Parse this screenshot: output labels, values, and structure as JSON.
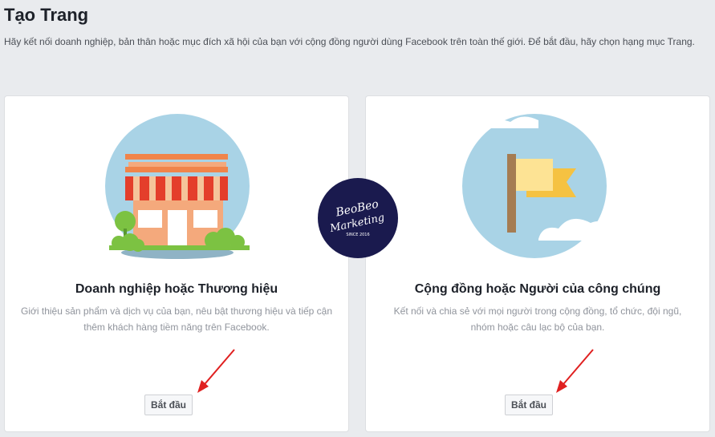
{
  "page": {
    "title": "Tạo Trang",
    "subtitle": "Hãy kết nối doanh nghiệp, bản thân hoặc mục đích xã hội của bạn với cộng đồng người dùng Facebook trên toàn thế giới. Để bắt đầu, hãy chọn hạng mục Trang."
  },
  "cards": [
    {
      "title": "Doanh nghiệp hoặc Thương hiệu",
      "description": "Giới thiệu sản phẩm và dịch vụ của bạn, nêu bật thương hiệu và tiếp cận thêm khách hàng tiềm năng trên Facebook.",
      "button_label": "Bắt đầu",
      "illustration_icon": "storefront-icon"
    },
    {
      "title": "Cộng đồng hoặc Người của công chúng",
      "description": "Kết nối và chia sẻ với mọi người trong cộng đồng, tổ chức, đội ngũ, nhóm hoặc câu lạc bộ của bạn.",
      "button_label": "Bắt đầu",
      "illustration_icon": "flag-icon"
    }
  ],
  "logo": {
    "line1": "BeoBeo",
    "line2": "Marketing",
    "line3": "SINCE 2016"
  },
  "colors": {
    "page_bg": "#e9ebee",
    "card_bg": "#ffffff",
    "circle_bg": "#a9d3e6",
    "arrow": "#e02020",
    "logo_bg": "#1a1a4e"
  }
}
